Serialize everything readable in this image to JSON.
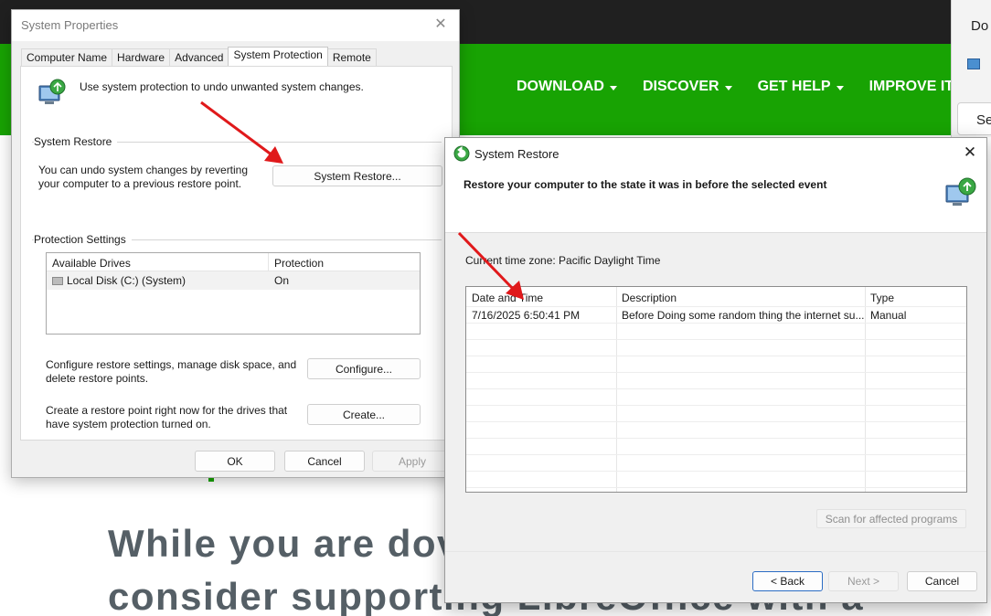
{
  "background_page": {
    "nav_items": [
      "DOWNLOAD",
      "DISCOVER",
      "GET HELP",
      "IMPROVE IT"
    ],
    "side_text": "Do",
    "side_box_text": "Se",
    "headline_line1": "While you are dov",
    "headline_line2": "consider supporting LibreOffice with a"
  },
  "system_properties": {
    "title": "System Properties",
    "close_glyph": "✕",
    "tabs": [
      "Computer Name",
      "Hardware",
      "Advanced",
      "System Protection",
      "Remote"
    ],
    "active_tab": "System Protection",
    "intro": "Use system protection to undo unwanted system changes.",
    "restore_group": "System Restore",
    "restore_desc": "You can undo system changes by reverting your computer to a previous restore point.",
    "restore_button": "System Restore...",
    "protection_group": "Protection Settings",
    "drives_headers": [
      "Available Drives",
      "Protection"
    ],
    "drives": [
      {
        "name": "Local Disk (C:) (System)",
        "protection": "On"
      }
    ],
    "configure_desc": "Configure restore settings, manage disk space, and delete restore points.",
    "configure_button": "Configure...",
    "create_desc": "Create a restore point right now for the drives that have system protection turned on.",
    "create_button": "Create...",
    "ok": "OK",
    "cancel": "Cancel",
    "apply": "Apply"
  },
  "system_restore": {
    "title": "System Restore",
    "close_glyph": "✕",
    "heading": "Restore your computer to the state it was in before the selected event",
    "timezone": "Current time zone: Pacific Daylight Time",
    "columns": [
      "Date and Time",
      "Description",
      "Type"
    ],
    "restore_points": [
      {
        "date": "7/16/2025 6:50:41 PM",
        "description": "Before Doing some random thing the internet su...",
        "type": "Manual"
      }
    ],
    "scan_button": "Scan for affected programs",
    "back_button": "< Back",
    "next_button": "Next >",
    "cancel_button": "Cancel"
  },
  "colors": {
    "brand_green": "#18a303",
    "annotation_red": "#e0191b",
    "dialog_bg": "#f0f0f0"
  }
}
